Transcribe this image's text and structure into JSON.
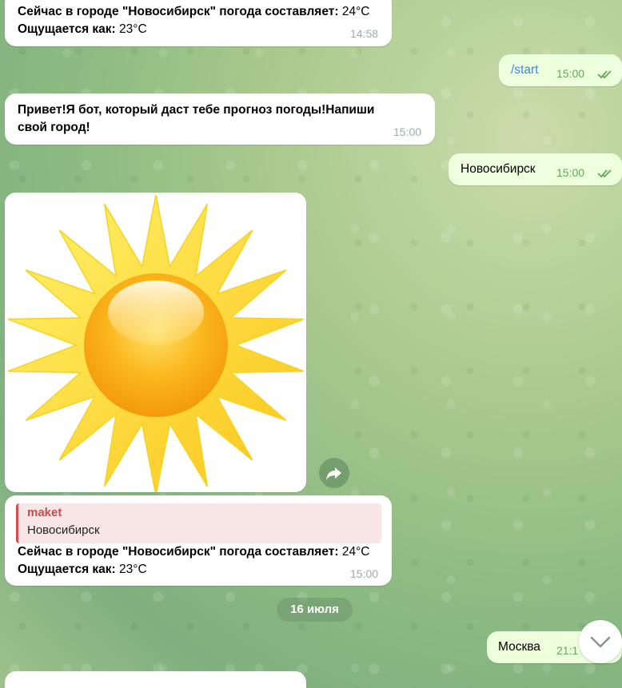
{
  "colors": {
    "incoming_bubble": "#ffffff",
    "outgoing_bubble": "#eeffde",
    "command_link": "#3a8ad8",
    "read_checks": "#5faa56",
    "reply_author": "#c84a4a"
  },
  "messages": [
    {
      "direction": "incoming",
      "line1_bold": "Сейчас в городе \"Новосибирск\" погода составляет:",
      "line1_value": " 24°C",
      "line2_bold": "Ощущается как:",
      "line2_value": " 23°C",
      "time": "14:58"
    },
    {
      "direction": "outgoing",
      "text": "/start",
      "time": "15:00",
      "status_icon": "double-check-icon"
    },
    {
      "direction": "incoming",
      "line1": "Привет!Я бот, который даст тебе прогноз погоды!Напиши",
      "line2": "свой город!",
      "time": "15:00"
    },
    {
      "direction": "outgoing",
      "text": "Новосибирск",
      "time": "15:00",
      "status_icon": "double-check-icon"
    },
    {
      "direction": "incoming",
      "type": "photo",
      "image": "sun-illustration",
      "share_icon": "share-arrow-icon"
    },
    {
      "direction": "incoming",
      "reply_author": "maket",
      "reply_text": "Новосибирск",
      "line1_bold": "Сейчас в городе \"Новосибирск\" погода составляет:",
      "line1_value": " 24°C",
      "line2_bold": "Ощущается как:",
      "line2_value": " 23°C",
      "time": "15:00"
    },
    {
      "direction": "outgoing",
      "text": "Москва",
      "time": "21:1"
    }
  ],
  "date_separator": "16 июля",
  "scroll_down_icon": "chevron-down-icon"
}
